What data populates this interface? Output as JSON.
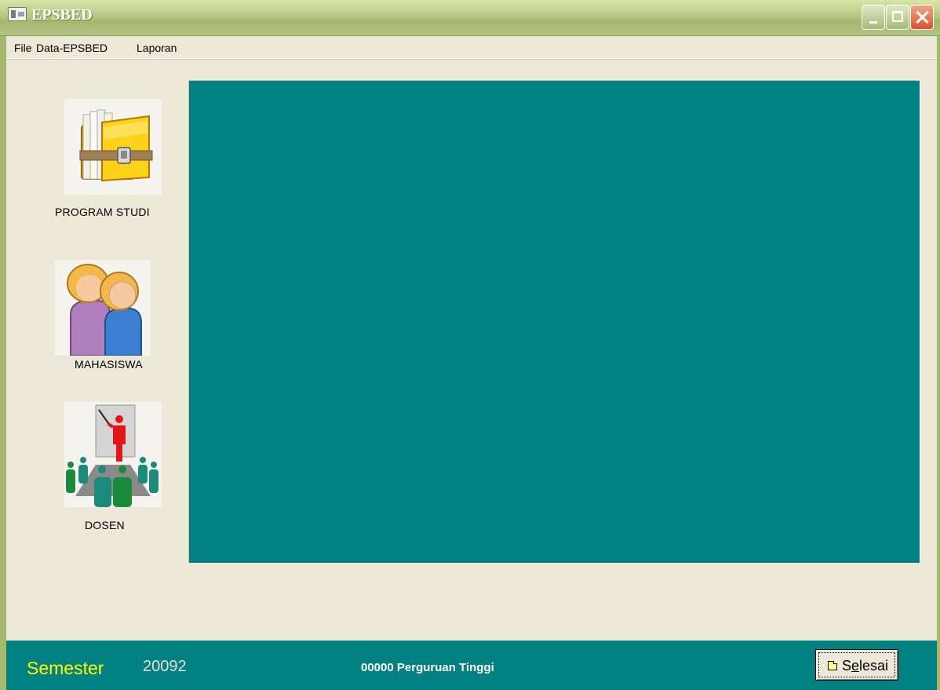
{
  "window": {
    "title": "EPSBED"
  },
  "menu": {
    "items": [
      {
        "label": "File"
      },
      {
        "label": "Data-EPSBED"
      },
      {
        "label": "Laporan"
      }
    ]
  },
  "sidebar": {
    "items": [
      {
        "label": "PROGRAM STUDI",
        "icon": "folder-archive-icon"
      },
      {
        "label": "MAHASISWA",
        "icon": "students-icon"
      },
      {
        "label": "DOSEN",
        "icon": "lecturer-icon"
      }
    ]
  },
  "status": {
    "semester_label": "Semester",
    "semester_value": "20092",
    "institution": "00000 Perguruan Tinggi"
  },
  "buttons": {
    "selesai_prefix": "S",
    "selesai_hotkey": "e",
    "selesai_suffix": "lesai"
  },
  "colors": {
    "panel": "#008080",
    "titlebar": "#a4b86e",
    "semester_label": "#ffff00"
  }
}
